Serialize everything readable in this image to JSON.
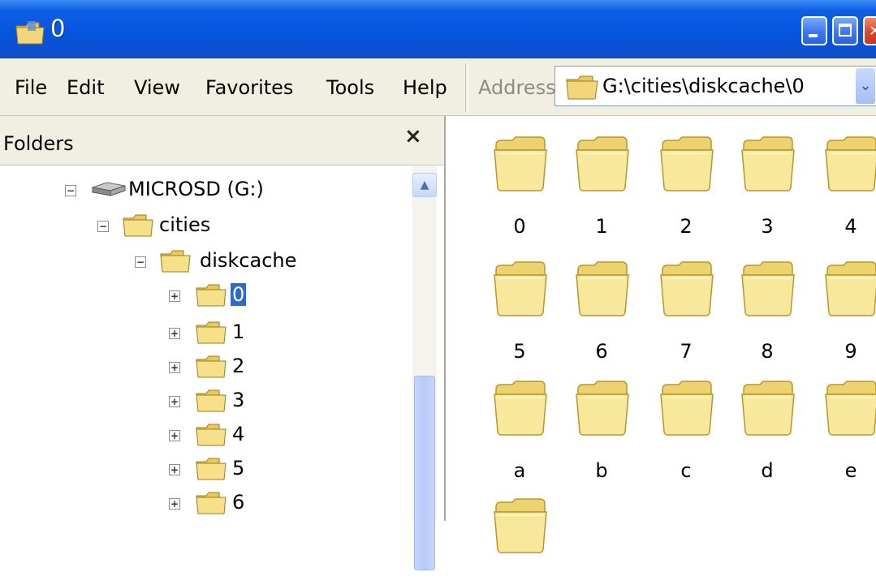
{
  "window": {
    "title": "0"
  },
  "menu": [
    "File",
    "Edit",
    "View",
    "Favorites",
    "Tools",
    "Help"
  ],
  "address": {
    "label": "Address",
    "value": "G:\\cities\\diskcache\\0"
  },
  "folders_pane": {
    "title": "Folders",
    "close_label": "×",
    "tree": [
      {
        "label": "MICROSD (G:)",
        "type": "drive",
        "expander": "⊟"
      },
      {
        "label": "cities",
        "type": "folder",
        "expander": "⊟"
      },
      {
        "label": "diskcache",
        "type": "folder",
        "expander": "⊟"
      },
      {
        "label": "0",
        "type": "folder",
        "expander": "⊞",
        "selected": true
      },
      {
        "label": "1",
        "type": "folder",
        "expander": "⊞"
      },
      {
        "label": "2",
        "type": "folder",
        "expander": "⊞"
      },
      {
        "label": "3",
        "type": "folder",
        "expander": "⊞"
      },
      {
        "label": "4",
        "type": "folder",
        "expander": "⊞"
      },
      {
        "label": "5",
        "type": "folder",
        "expander": "⊞"
      },
      {
        "label": "6",
        "type": "folder",
        "expander": "⊞"
      }
    ]
  },
  "files": [
    "0",
    "1",
    "2",
    "3",
    "4",
    "5",
    "6",
    "7",
    "8",
    "9",
    "a",
    "b",
    "c",
    "d",
    "e",
    ""
  ],
  "colors": {
    "titlebar": "#0755e0",
    "selection": "#316ac5",
    "folder": "#f7e79a"
  }
}
